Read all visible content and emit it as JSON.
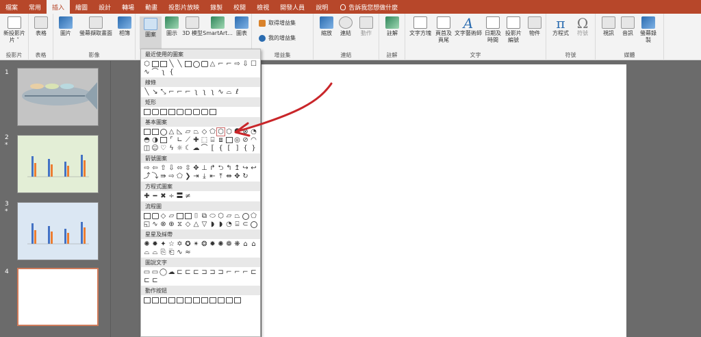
{
  "tabs": [
    "檔案",
    "常用",
    "插入",
    "繪圖",
    "設計",
    "轉場",
    "動畫",
    "投影片放映",
    "錄製",
    "校閱",
    "檢視",
    "開發人員",
    "說明"
  ],
  "active_tab": "插入",
  "tell_me": "告訴我您想做什麼",
  "ribbon": {
    "new_slide": "新投影片",
    "new_slide_sub": "片 ˅",
    "table": "表格",
    "picture": "圖片",
    "screenshot": "螢幕擷取畫面",
    "album": "相簿",
    "shapes": "圖案",
    "icons": "圖示",
    "model3d": "3D 模型",
    "smartart": "SmartArt...",
    "chart": "圖表",
    "get_addins": "取得增益集",
    "my_addins": "我的增益集",
    "zoom": "縮放",
    "link": "連結",
    "action": "動作",
    "comment": "註解",
    "textbox": "文字方塊",
    "header_footer": "頁首及頁尾",
    "wordart": "文字藝術師",
    "date_time": "日期及時間",
    "slide_number": "投影片編號",
    "object": "物件",
    "equation": "方程式",
    "symbol": "符號",
    "video": "視訊",
    "audio": "音訊",
    "screen_record": "螢幕錄製",
    "groups": {
      "slides": "投影片",
      "tables": "表格",
      "images": "影像",
      "addins": "增益集",
      "links": "連結",
      "comments": "註解",
      "text": "文字",
      "symbols": "符號",
      "media": "媒體"
    }
  },
  "gallery": {
    "sections": [
      "最近使用的圖案",
      "線條",
      "矩形",
      "基本圖案",
      "箭號圖案",
      "方程式圖案",
      "流程圖",
      "星星及綵帶",
      "圖說文字",
      "動作按鈕"
    ]
  },
  "slides": [
    {
      "number": "1",
      "star": ""
    },
    {
      "number": "2",
      "star": "*"
    },
    {
      "number": "3",
      "star": "*"
    },
    {
      "number": "4",
      "star": ""
    }
  ],
  "colors": {
    "accent": "#b7472a",
    "annotation_arrow": "#c9262a"
  }
}
